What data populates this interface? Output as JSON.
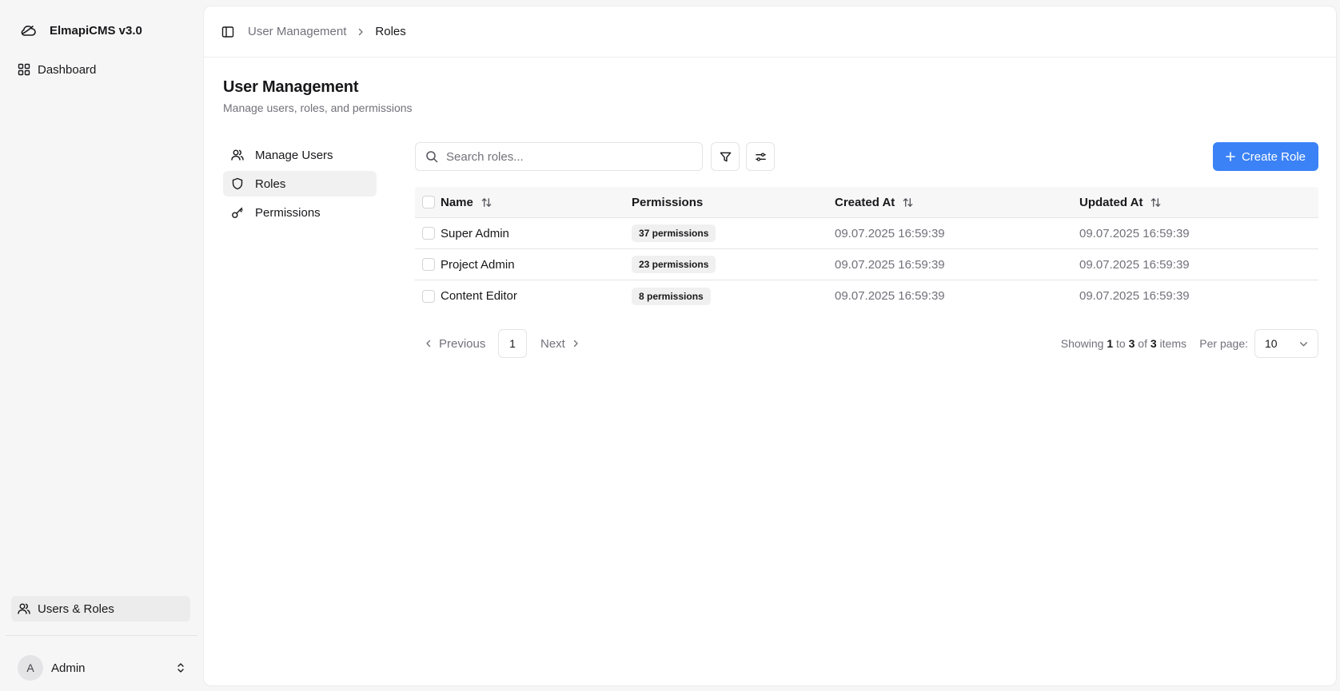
{
  "app": {
    "title": "ElmapiCMS v3.0"
  },
  "sidebar": {
    "dashboard_label": "Dashboard",
    "users_roles_label": "Users & Roles",
    "user": {
      "initial": "A",
      "name": "Admin"
    }
  },
  "breadcrumb": {
    "parent": "User Management",
    "current": "Roles"
  },
  "page": {
    "title": "User Management",
    "subtitle": "Manage users, roles, and permissions"
  },
  "subnav": {
    "items": [
      {
        "label": "Manage Users",
        "icon": "users-icon"
      },
      {
        "label": "Roles",
        "icon": "shield-icon",
        "active": true
      },
      {
        "label": "Permissions",
        "icon": "key-icon"
      }
    ]
  },
  "toolbar": {
    "search_placeholder": "Search roles...",
    "create_label": "Create Role"
  },
  "table": {
    "headers": {
      "name": "Name",
      "permissions": "Permissions",
      "created": "Created At",
      "updated": "Updated At"
    },
    "rows": [
      {
        "name": "Super Admin",
        "permissions": "37 permissions",
        "created": "09.07.2025 16:59:39",
        "updated": "09.07.2025 16:59:39"
      },
      {
        "name": "Project Admin",
        "permissions": "23 permissions",
        "created": "09.07.2025 16:59:39",
        "updated": "09.07.2025 16:59:39"
      },
      {
        "name": "Content Editor",
        "permissions": "8 permissions",
        "created": "09.07.2025 16:59:39",
        "updated": "09.07.2025 16:59:39"
      }
    ]
  },
  "pagination": {
    "prev_label": "Previous",
    "next_label": "Next",
    "current_page": "1",
    "showing_prefix": "Showing ",
    "from": "1",
    "to_word": " to ",
    "to": "3",
    "of_word": " of ",
    "total": "3",
    "items_word": " items",
    "per_page_label": "Per page:",
    "per_page_value": "10"
  },
  "colors": {
    "accent": "#3b82f6",
    "muted_text": "#71717a",
    "border": "#e4e4e7"
  }
}
